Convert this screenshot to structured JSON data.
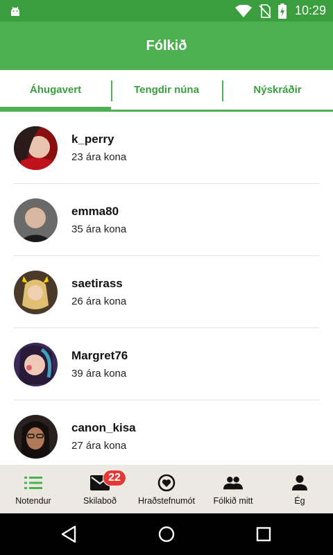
{
  "status_bar": {
    "time": "10:29",
    "icons": [
      "android-icon",
      "wifi-icon",
      "no-sim-icon",
      "battery-charging-icon"
    ]
  },
  "app_bar": {
    "title": "Fólkið",
    "color": "#4caf50"
  },
  "tabs": [
    {
      "label": "Áhugavert",
      "active": true
    },
    {
      "label": "Tengdir núna",
      "active": false
    },
    {
      "label": "Nýskráðir",
      "active": false
    }
  ],
  "users": [
    {
      "username": "k_perry",
      "info": "23 ára kona"
    },
    {
      "username": "emma80",
      "info": "35 ára kona"
    },
    {
      "username": "saetirass",
      "info": "26 ára kona"
    },
    {
      "username": "Margret76",
      "info": "39 ára kona"
    },
    {
      "username": "canon_kisa",
      "info": "27 ára kona"
    }
  ],
  "bottom_nav": {
    "items": [
      {
        "label": "Notendur",
        "icon": "list-icon",
        "active": true
      },
      {
        "label": "Skilaboð",
        "icon": "mail-icon",
        "badge": "22"
      },
      {
        "label": "Hraðstefnumót",
        "icon": "heart-circle-icon"
      },
      {
        "label": "Fólkið mitt",
        "icon": "people-icon"
      },
      {
        "label": "Ég",
        "icon": "person-icon"
      }
    ]
  },
  "system_nav": [
    "back-icon",
    "home-icon",
    "recents-icon"
  ],
  "colors": {
    "accent": "#4caf50",
    "status_bar": "#3a9e3e",
    "badge": "#e53935",
    "bottom_nav_bg": "#ece8e2"
  }
}
